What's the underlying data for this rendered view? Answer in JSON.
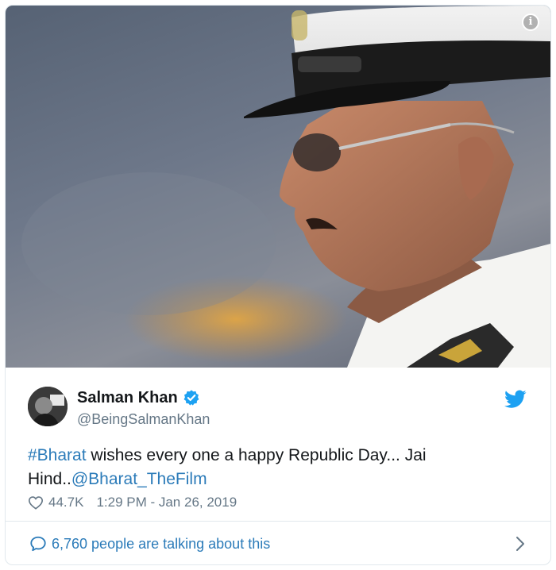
{
  "tweet": {
    "display_name": "Salman Khan",
    "handle": "@BeingSalmanKhan",
    "text_parts": {
      "hashtag": "#Bharat",
      "body": " wishes every one a happy Republic Day... Jai Hind..",
      "mention": "@Bharat_TheFilm"
    },
    "likes": "44.7K",
    "timestamp": "1:29 PM - Jan 26, 2019"
  },
  "footer": {
    "talking_text": "6,760 people are talking about this"
  },
  "icons": {
    "info": "info-icon",
    "verified": "verified-badge-icon",
    "twitter": "twitter-bird-icon",
    "like": "heart-icon",
    "reply": "speech-bubble-icon",
    "more": "chevron-right-icon"
  },
  "colors": {
    "link": "#2b7bb9",
    "verified": "#1da1f2",
    "muted": "#657786",
    "border": "#e1e8ed"
  }
}
